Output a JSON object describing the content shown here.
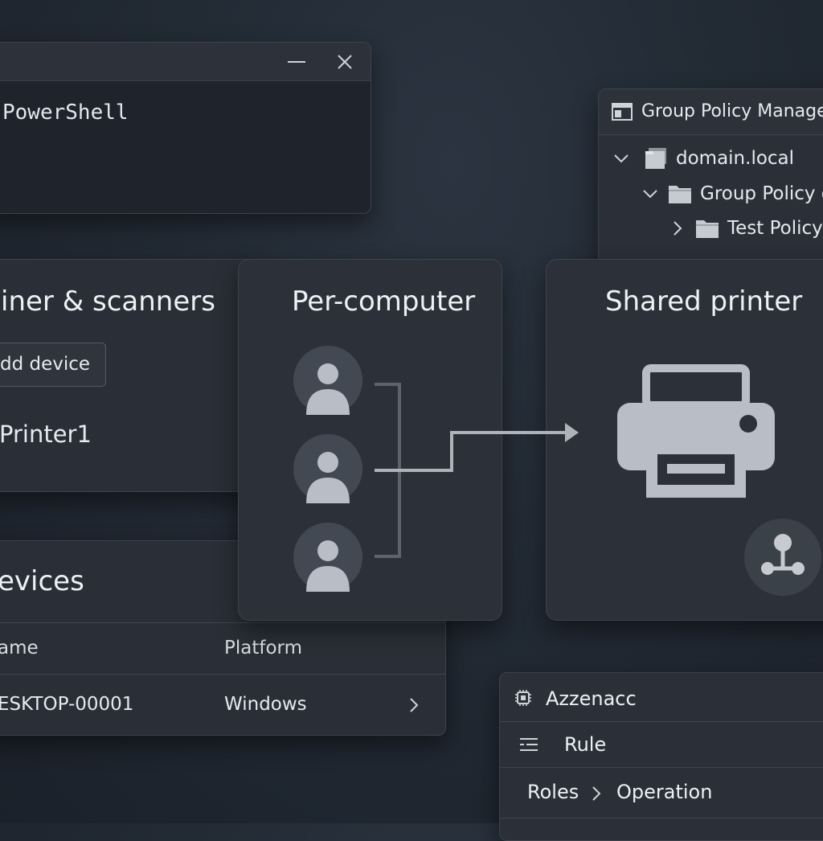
{
  "powershell": {
    "title": "PowerShell",
    "minimize_icon": "minimize-icon",
    "close_icon": "close-icon"
  },
  "group_policy": {
    "title": "Group Policy Manage",
    "tree": [
      {
        "label": "domain.local",
        "expanded": true
      },
      {
        "label": "Group Policy o",
        "expanded": true
      },
      {
        "label": "Test Policy",
        "expanded": false
      }
    ]
  },
  "printers": {
    "title": "iner & scanners",
    "add_device_label": "dd device",
    "printer_name": "Printer1"
  },
  "devices": {
    "title": "evices",
    "columns": [
      "ame",
      "Platform"
    ],
    "rows": [
      {
        "name": "ESKTOP-00001",
        "platform": "Windows"
      }
    ]
  },
  "per_computer": {
    "title": "Per-computer",
    "user_icons": [
      "user-icon",
      "user-icon",
      "user-icon"
    ]
  },
  "shared_printer": {
    "title": "Shared printer",
    "icon": "printer-icon",
    "badge_icon": "network-share-icon"
  },
  "azzenacc": {
    "title": "Azzenacc",
    "rule_label": "Rule",
    "breadcrumb": [
      "Roles",
      "Operation"
    ]
  },
  "colors": {
    "background": "#222a34",
    "panel": "#2a2f37",
    "text": "#e6e9ee",
    "icon": "#b9bec6"
  }
}
